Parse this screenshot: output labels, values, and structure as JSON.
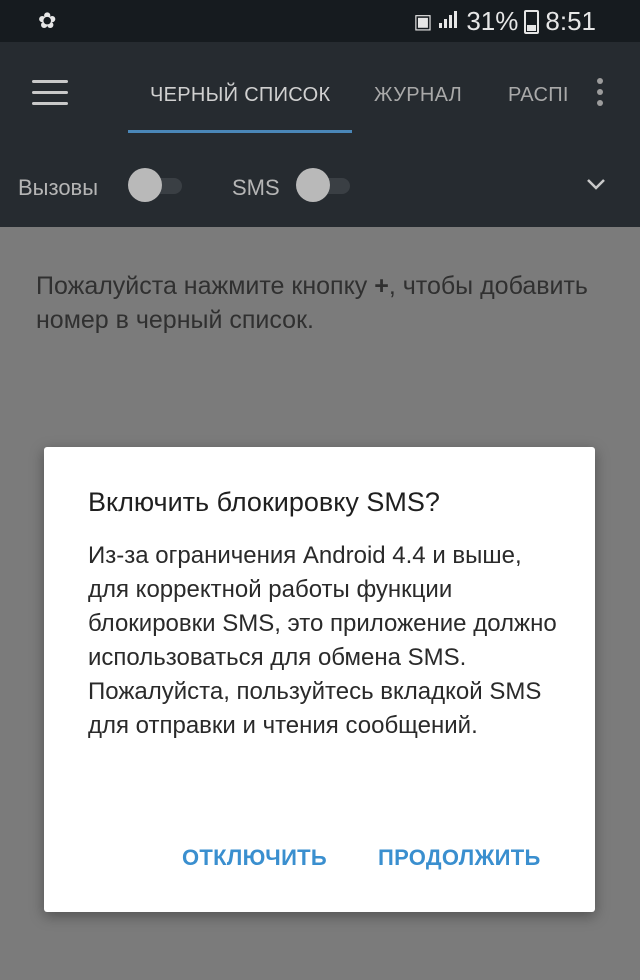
{
  "status_bar": {
    "left_icon": "flower-icon",
    "signal_icon": "signal-icon",
    "battery_percent": "31%",
    "time": "8:51"
  },
  "app_bar": {
    "tabs": [
      {
        "label": "ЧЕРНЫЙ СПИСОК",
        "active": true
      },
      {
        "label": "ЖУРНАЛ",
        "active": false
      },
      {
        "label": "РАСПІ",
        "active": false
      }
    ],
    "toggles": [
      {
        "label": "Вызовы",
        "on": false
      },
      {
        "label": "SMS",
        "on": false
      }
    ]
  },
  "content": {
    "empty_text_before": "Пожалуйста нажмите кнопку ",
    "empty_text_plus": "+",
    "empty_text_after": ", чтобы добавить номер в черный список."
  },
  "dialog": {
    "title": "Включить блокировку SMS?",
    "body": "Из-за ограничения Android 4.4 и выше, для корректной работы функции блокировки SMS, это приложение должно использоваться для обмена SMS. Пожалуйста, пользуйтесь вкладкой SMS для отправки и чтения сообщений.",
    "negative_button": "ОТКЛЮЧИТЬ",
    "positive_button": "ПРОДОЛЖИТЬ"
  },
  "colors": {
    "accent": "#3a8fcf",
    "appbar_bg": "#262b30",
    "scrim_bg": "#7b7b7b"
  }
}
